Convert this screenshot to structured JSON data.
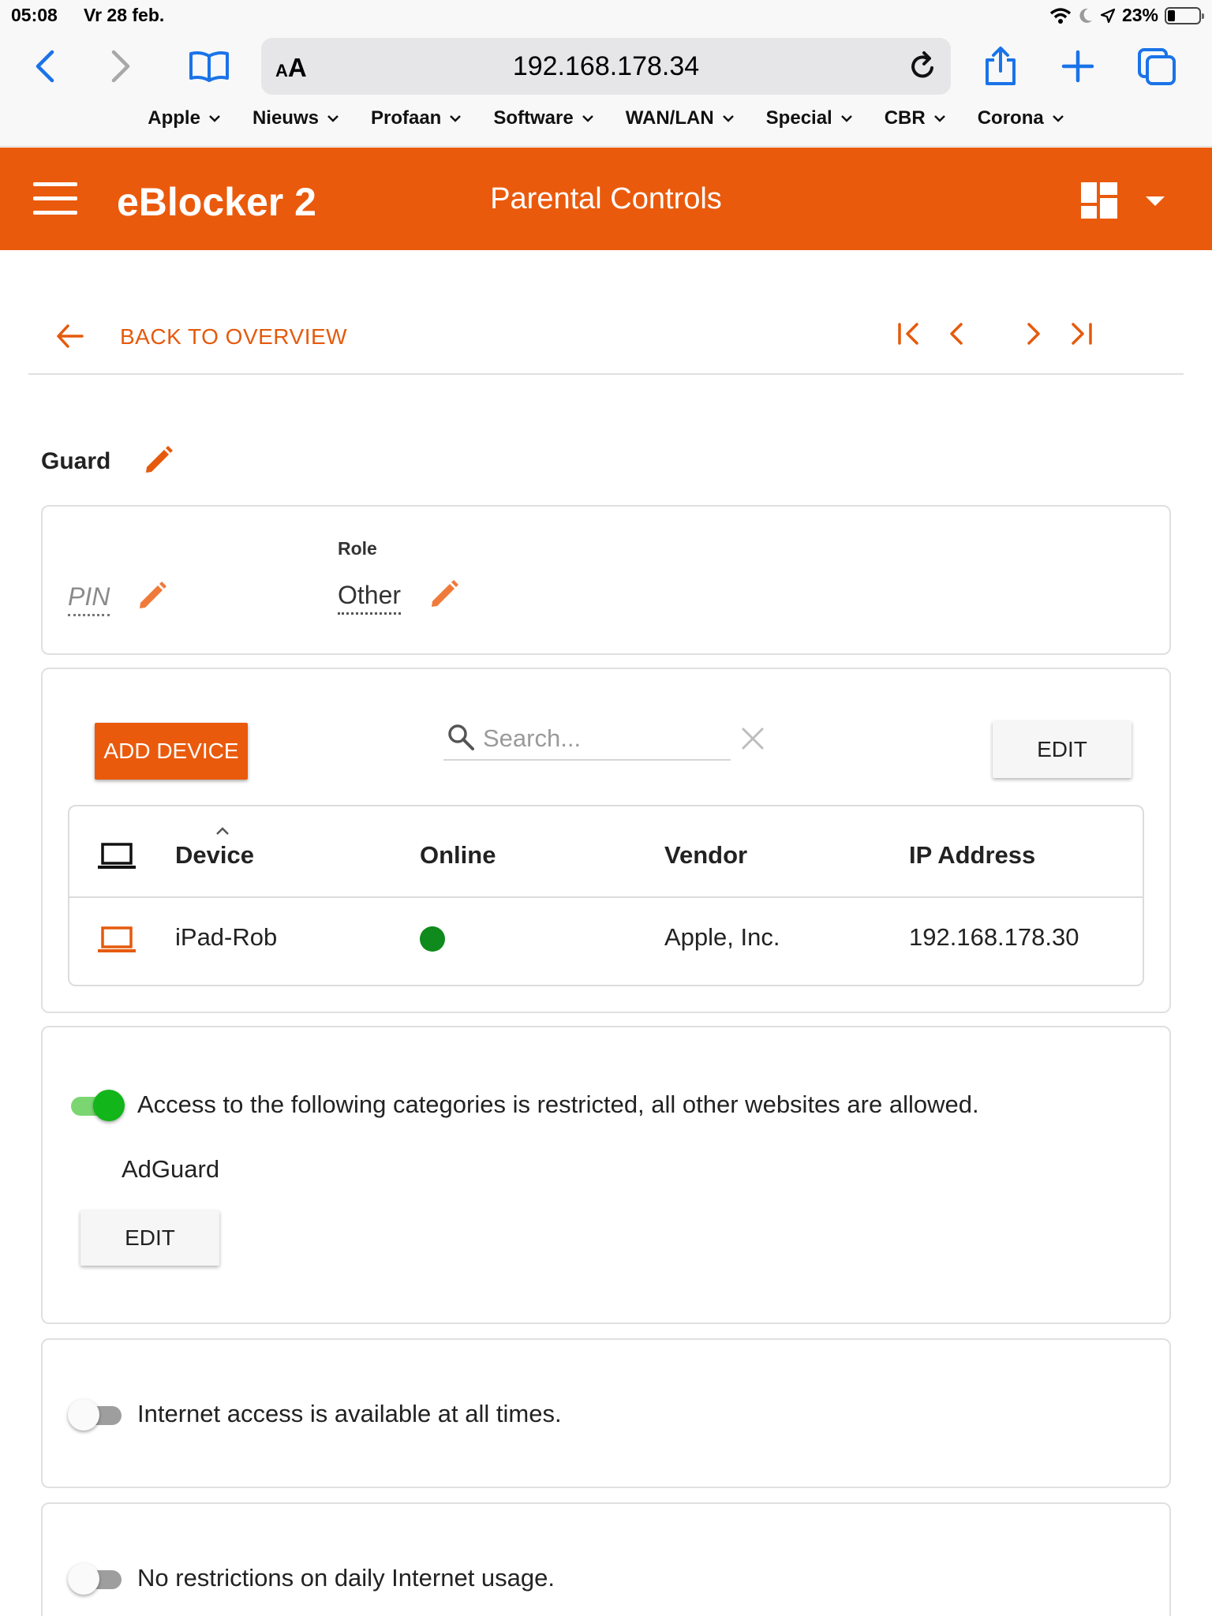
{
  "status_bar": {
    "time": "05:08",
    "date": "Vr 28 feb.",
    "battery": "23%"
  },
  "browser": {
    "text_size_label": "AA",
    "url": "192.168.178.34",
    "bookmarks": [
      "Apple",
      "Nieuws",
      "Profaan",
      "Software",
      "WAN/LAN",
      "Special",
      "CBR",
      "Corona"
    ]
  },
  "app": {
    "brand": "eBlocker 2",
    "page_title": "Parental Controls",
    "accent": "#ea5a0c"
  },
  "nav": {
    "back_label": "BACK TO OVERVIEW"
  },
  "profile": {
    "name": "Guard",
    "pin_label": "PIN",
    "role_caption": "Role",
    "role_value": "Other"
  },
  "devices": {
    "add_button": "ADD DEVICE",
    "search_placeholder": "Search...",
    "edit_button": "EDIT",
    "columns": [
      "Device",
      "Online",
      "Vendor",
      "IP Address"
    ],
    "rows": [
      {
        "device": "iPad-Rob",
        "online": true,
        "vendor": "Apple, Inc.",
        "ip": "192.168.178.30"
      }
    ]
  },
  "restrictions": {
    "enabled": true,
    "text": "Access to the following categories is restricted, all other websites are allowed.",
    "category": "AdGuard",
    "edit_button": "EDIT"
  },
  "time_limits": {
    "enabled": false,
    "text": "Internet access is available at all times."
  },
  "daily_usage": {
    "enabled": false,
    "text": "No restrictions on daily Internet usage."
  }
}
